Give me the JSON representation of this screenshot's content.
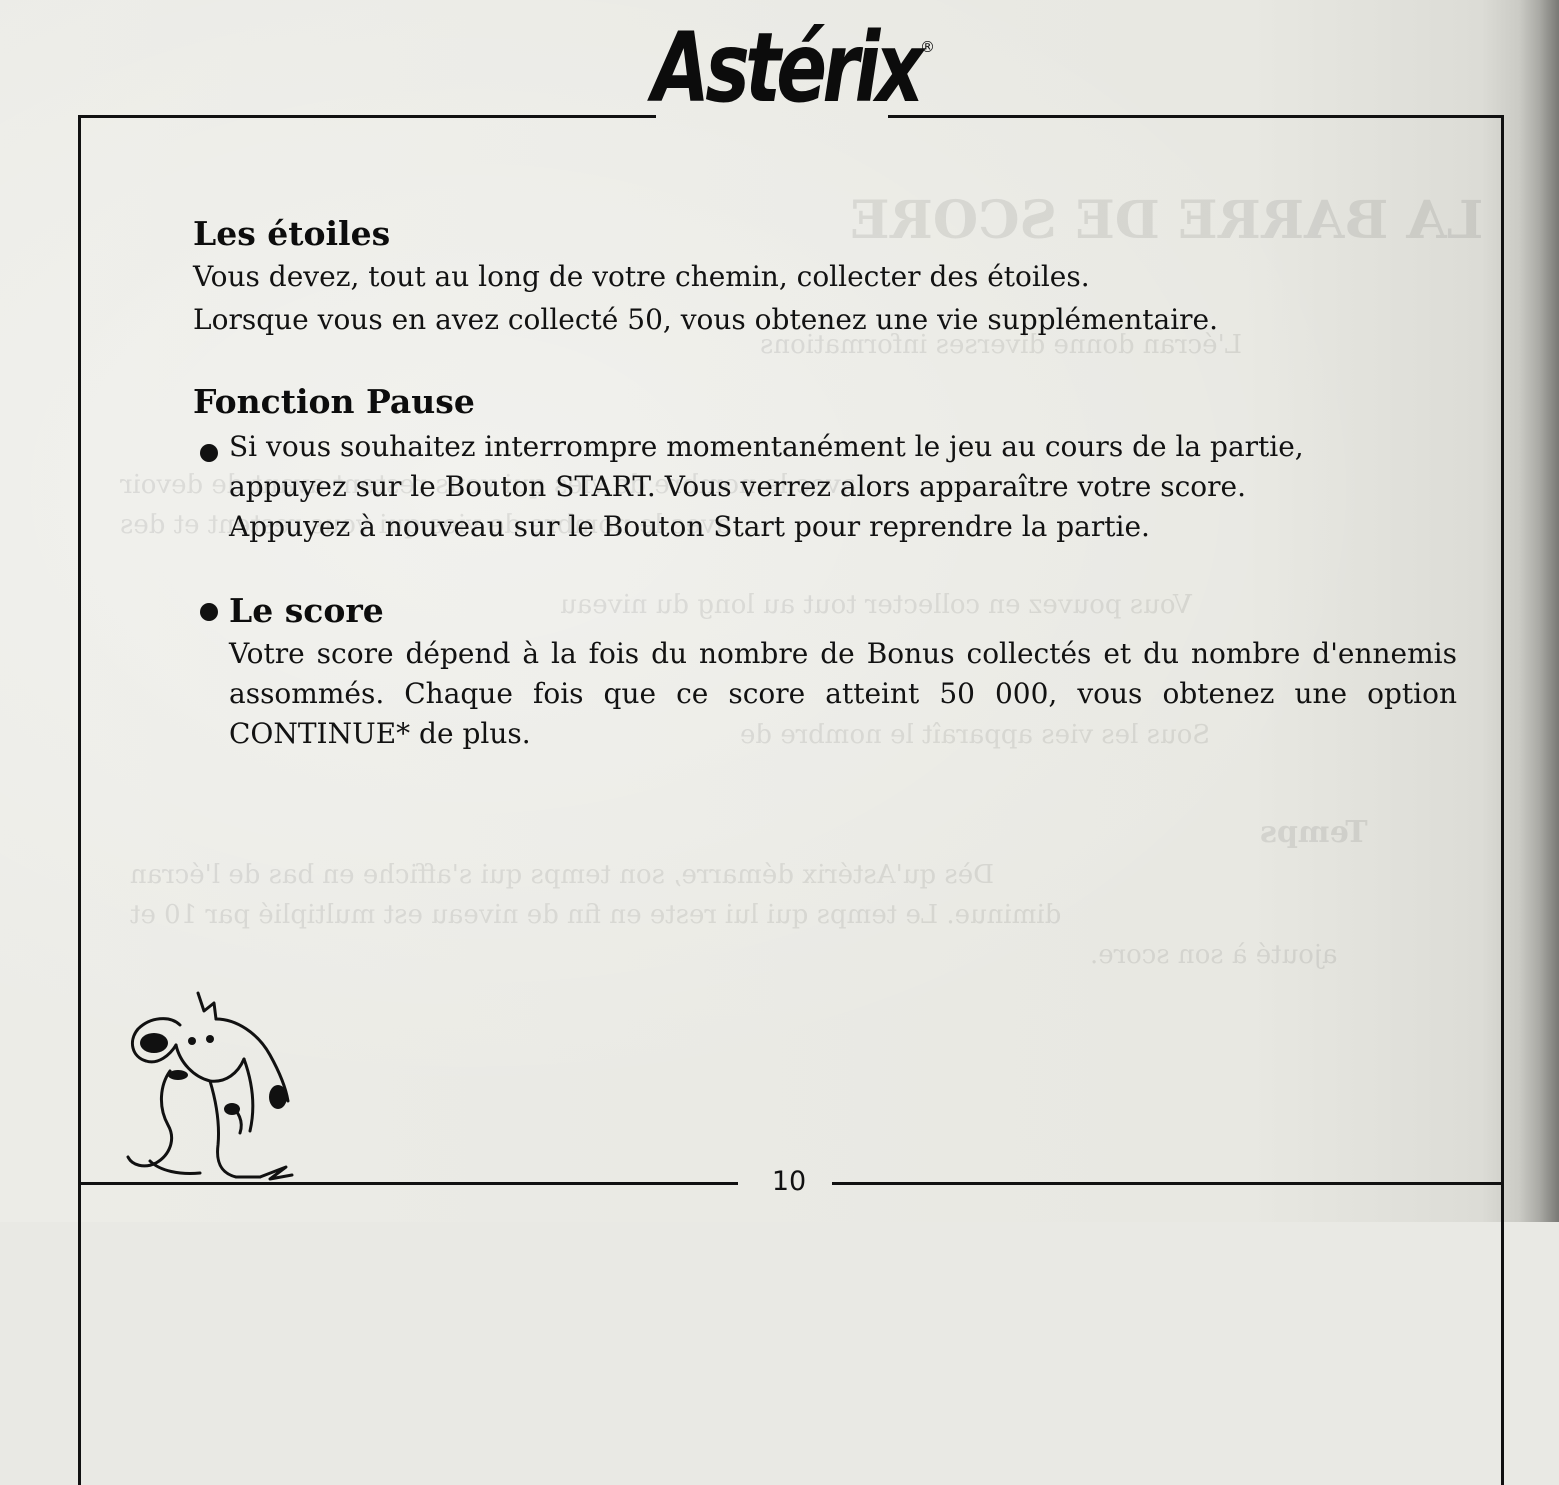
{
  "logo": {
    "text": "Astérix",
    "registered_mark": "®"
  },
  "sections": {
    "etoiles": {
      "title": "Les étoiles",
      "lines": [
        "Vous devez, tout au long de votre chemin, collecter des étoiles.",
        "Lorsque vous en avez collecté 50, vous obtenez une vie supplémentaire."
      ]
    },
    "pause": {
      "title": "Fonction Pause",
      "lines": [
        "Si vous souhaitez interrompre momentanément le jeu au cours de la partie,",
        "appuyez sur le Bouton START. Vous verrez alors apparaître votre score.",
        "Appuyez à nouveau sur le Bouton Start pour reprendre la partie."
      ]
    },
    "score": {
      "title": "Le score",
      "text": "Votre score dépend à la fois du nombre de Bonus collectés et du nombre d'ennemis assommés. Chaque fois que ce score atteint 50 000, vous obtenez une option CONTINUE* de plus."
    }
  },
  "page_number": "10"
}
